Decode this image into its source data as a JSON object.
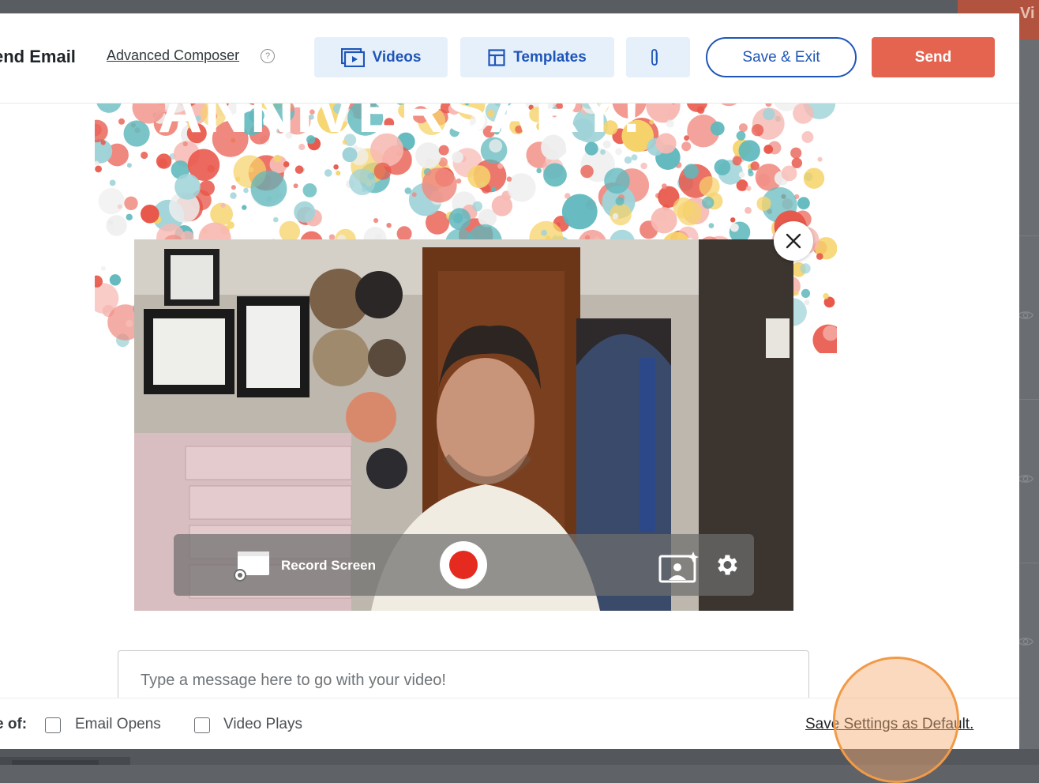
{
  "background": {
    "right_button_text": "Vi",
    "colors": {
      "overlay": "#5f6266",
      "orange_button": "#b1533e"
    }
  },
  "header": {
    "title": "end Email",
    "advanced_composer": "Advanced Composer",
    "help_icon": "?",
    "videos_label": "Videos",
    "templates_label": "Templates",
    "attach_icon": "paperclip-icon",
    "save_exit_label": "Save & Exit",
    "send_label": "Send"
  },
  "banner": {
    "text": "ANNIVERSARY!"
  },
  "recorder": {
    "record_screen_label": "Record Screen",
    "close_icon": "close-icon",
    "record_icon": "record-icon",
    "background_icon": "virtual-background-icon",
    "settings_icon": "gear-icon"
  },
  "message": {
    "placeholder": "Type a message here to go with your video!"
  },
  "footer": {
    "notify_label": "e of:",
    "email_opens": {
      "label": "Email Opens",
      "checked": false
    },
    "video_plays": {
      "label": "Video Plays",
      "checked": false
    },
    "save_default": "Save Settings as Default."
  },
  "colors": {
    "brand_blue": "#1e55b8",
    "send_red": "#e56450",
    "light_button": "#e6f0fb",
    "record_red": "#e52a1f",
    "click_highlight": "#f19a48"
  }
}
